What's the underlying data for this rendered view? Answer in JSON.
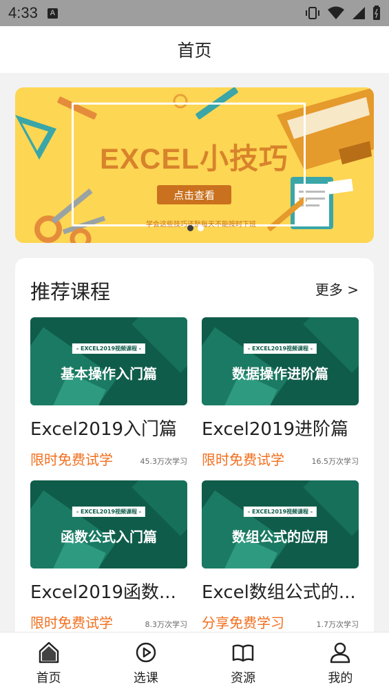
{
  "status": {
    "time": "4:33"
  },
  "header": {
    "title": "首页"
  },
  "banner": {
    "title": "EXCEL小技巧",
    "button": "点击查看",
    "subtitle": "学会这些技巧还愁每天不能按时下班",
    "dots": 2,
    "active_dot": 0
  },
  "recommend": {
    "title": "推荐课程",
    "more": "更多 >",
    "courses": [
      {
        "tag": "- EXCEL2019视频课程 -",
        "thumb_title": "基本操作入门篇",
        "name": "Excel2019入门篇",
        "promo": "限时免费试学",
        "count": "45.3万次学习"
      },
      {
        "tag": "- EXCEL2019视频课程 -",
        "thumb_title": "数据操作进阶篇",
        "name": "Excel2019进阶篇",
        "promo": "限时免费试学",
        "count": "16.5万次学习"
      },
      {
        "tag": "- EXCEL2019视频课程 -",
        "thumb_title": "函数公式入门篇",
        "name": "Excel2019函数...",
        "promo": "限时免费试学",
        "count": "8.3万次学习"
      },
      {
        "tag": "- EXCEL2019视频课程 -",
        "thumb_title": "数组公式的应用",
        "name": "Excel数组公式的...",
        "promo": "分享免费学习",
        "count": "1.7万次学习"
      }
    ]
  },
  "tabs": [
    {
      "label": "首页",
      "icon": "home-icon"
    },
    {
      "label": "选课",
      "icon": "play-circle-icon"
    },
    {
      "label": "资源",
      "icon": "book-icon"
    },
    {
      "label": "我的",
      "icon": "user-icon"
    }
  ],
  "colors": {
    "accent": "#f26f1e",
    "course_green": "#0f5c4a",
    "banner_yellow": "#fdd653"
  }
}
